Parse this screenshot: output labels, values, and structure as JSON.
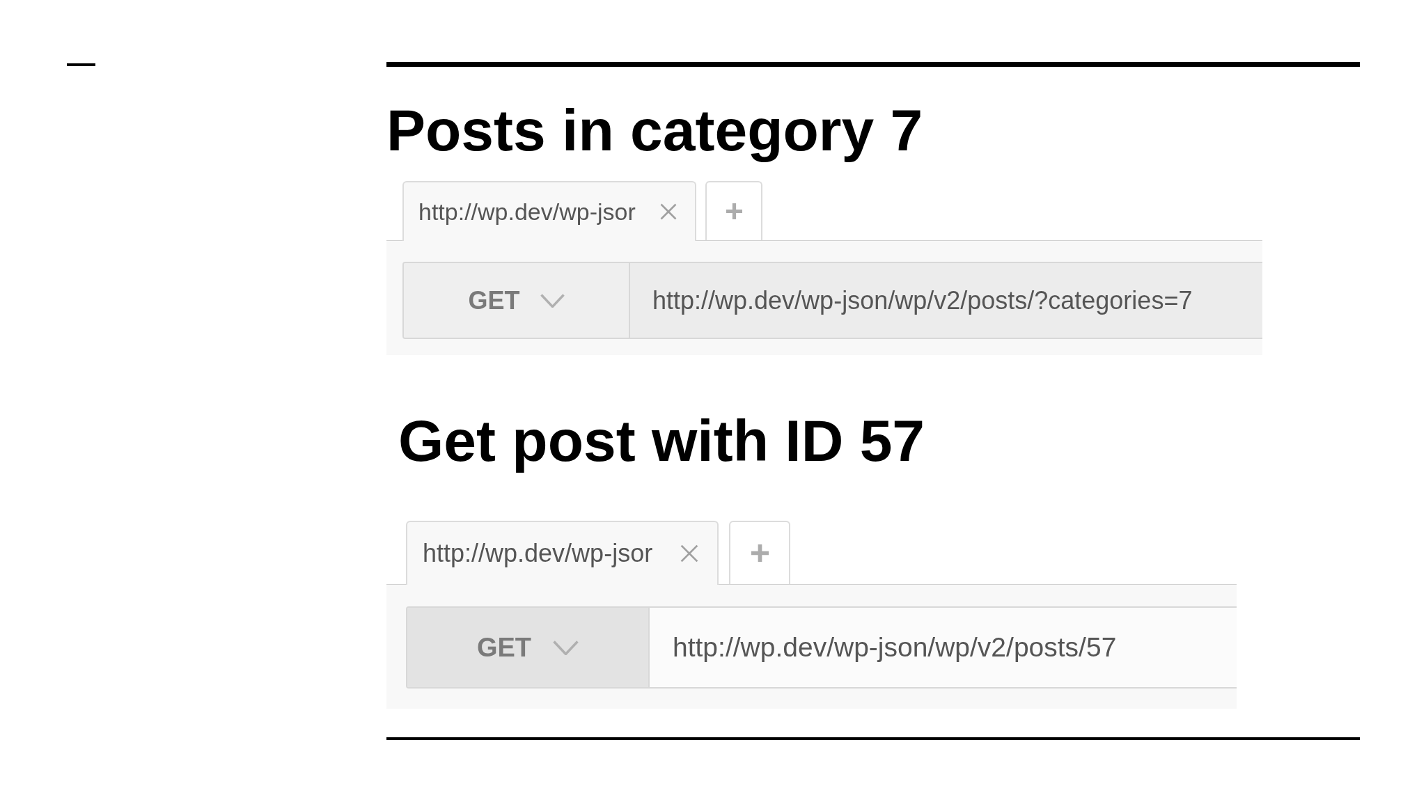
{
  "sections": [
    {
      "title": "Posts in category 7",
      "request_panel": {
        "tabs": [
          {
            "label": "http://wp.dev/wp-jsor",
            "selected": true
          }
        ],
        "method_select": {
          "label": "GET",
          "hovered": false
        },
        "url_field": {
          "value": "http://wp.dev/wp-json/wp/v2/posts/?categories=7",
          "hovered": true
        }
      }
    },
    {
      "title": "Get post with ID 57",
      "request_panel": {
        "tabs": [
          {
            "label": "http://wp.dev/wp-jsor",
            "selected": true
          }
        ],
        "method_select": {
          "label": "GET",
          "hovered": true
        },
        "url_field": {
          "value": "http://wp.dev/wp-json/wp/v2/posts/57",
          "hovered": false
        }
      }
    }
  ]
}
